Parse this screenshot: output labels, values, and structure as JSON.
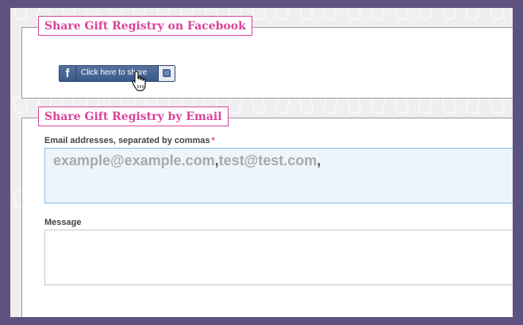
{
  "facebook_section": {
    "title": "Share Gift Registry on Facebook",
    "share_button": {
      "logo": "f",
      "label": "Click here to share",
      "icons": [
        "facebook-logo-icon",
        "share-bubble-icon"
      ]
    },
    "cursor": "hand-pointer-icon"
  },
  "email_section": {
    "title": "Share Gift Registry by Email",
    "emails_label": "Email addresses, separated by commas",
    "required_mark": "*",
    "emails_value": {
      "first": "example@example.com",
      "separator": ",",
      "second": "test@test.com",
      "trailing": ","
    },
    "message_label": "Message",
    "message_value": ""
  },
  "colors": {
    "frame": "#5e527f",
    "accent_pink": "#d8439a",
    "facebook_blue": "#3b5a8b",
    "input_focus_bg": "#edf4fa",
    "input_focus_border": "#86bce6"
  }
}
